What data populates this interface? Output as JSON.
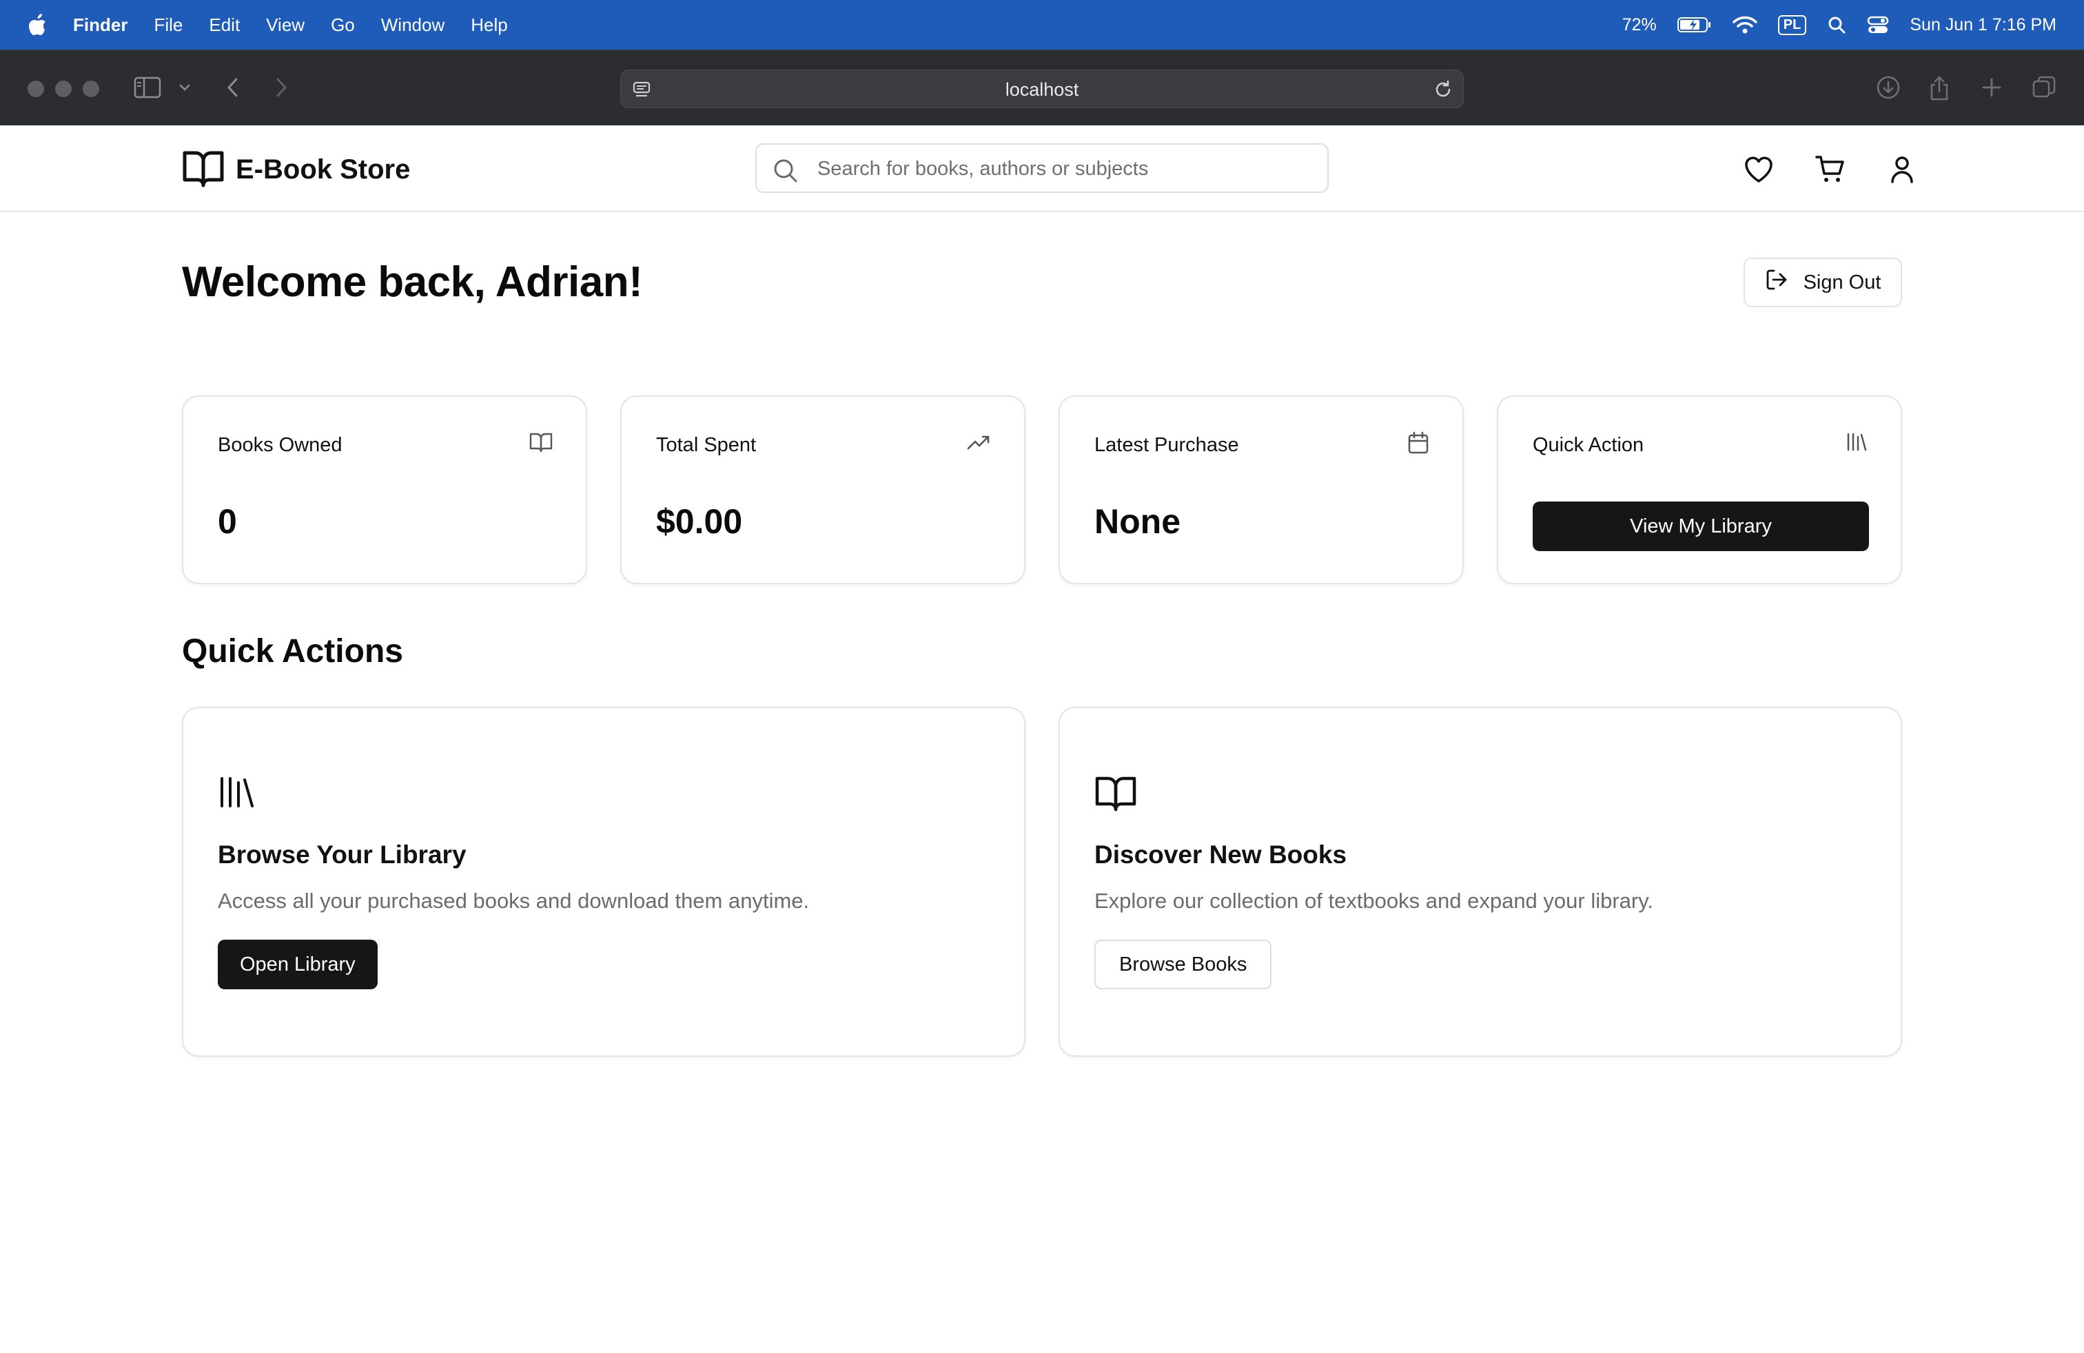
{
  "menubar": {
    "app_name": "Finder",
    "items": [
      "File",
      "Edit",
      "View",
      "Go",
      "Window",
      "Help"
    ],
    "battery": "72%",
    "input_source": "PL",
    "datetime": "Sun Jun 1  7:16 PM"
  },
  "browser": {
    "url": "localhost"
  },
  "header": {
    "brand": "E-Book Store",
    "search_placeholder": "Search for books, authors or subjects",
    "icons": [
      "heart-icon",
      "cart-icon",
      "user-icon"
    ]
  },
  "dashboard": {
    "welcome": "Welcome back, Adrian!",
    "sign_out_label": "Sign Out",
    "stats": [
      {
        "label": "Books Owned",
        "value": "0",
        "icon": "book-open-icon"
      },
      {
        "label": "Total Spent",
        "value": "$0.00",
        "icon": "trending-up-icon"
      },
      {
        "label": "Latest Purchase",
        "value": "None",
        "icon": "calendar-icon"
      },
      {
        "label": "Quick Action",
        "button": "View My Library",
        "icon": "library-icon"
      }
    ],
    "quick_actions_title": "Quick Actions",
    "quick_actions": [
      {
        "title": "Browse Your Library",
        "description": "Access all your purchased books and download them anytime.",
        "button": "Open Library",
        "icon": "library-icon"
      },
      {
        "title": "Discover New Books",
        "description": "Explore our collection of textbooks and expand your library.",
        "button": "Browse Books",
        "icon": "book-open-icon"
      }
    ]
  },
  "colors": {
    "menubar": "#1f5bb8",
    "chrome": "#2b2d30",
    "primary_button": "#161616",
    "muted_text": "#6b6b6b",
    "border": "#e4e4e4"
  }
}
